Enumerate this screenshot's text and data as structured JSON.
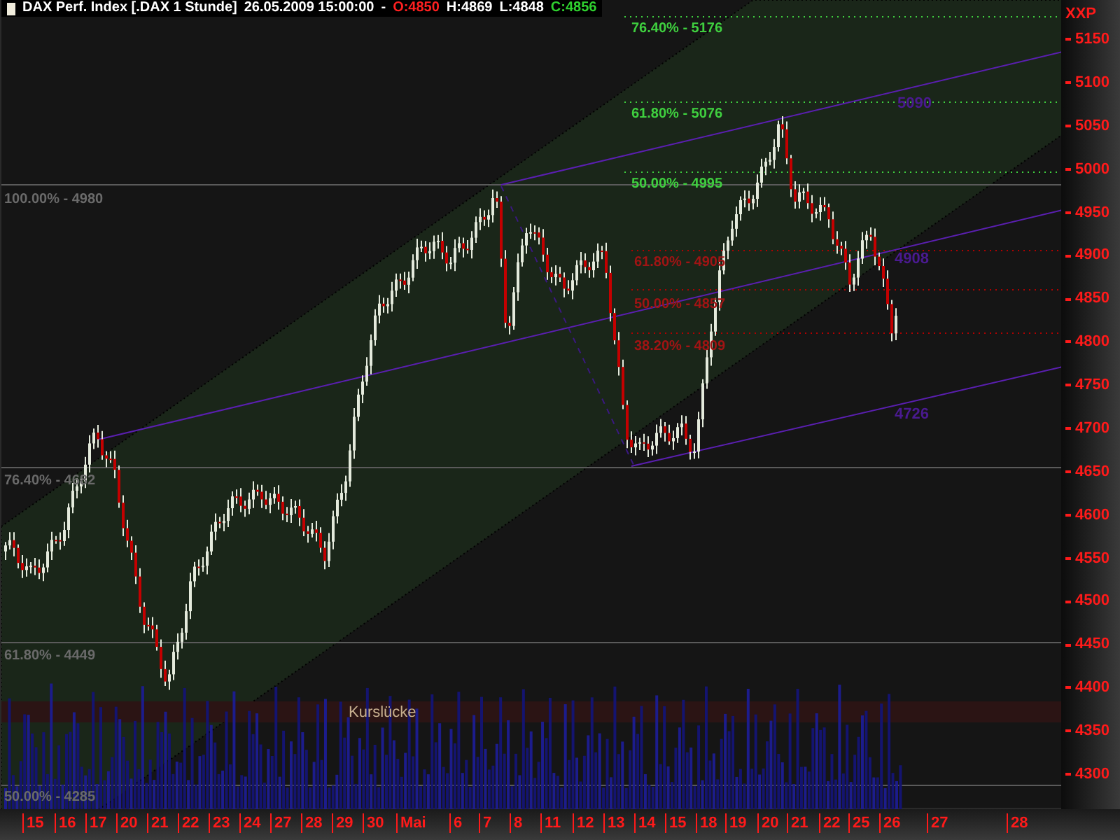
{
  "header": {
    "title": "DAX Perf. Index [.DAX  1 Stunde]",
    "datetime": "26.05.2009 15:00:00",
    "separator": "-",
    "quotes": [
      {
        "label": "O:4850",
        "kind": "open"
      },
      {
        "label": "H:4869",
        "kind": "high"
      },
      {
        "label": "L:4848",
        "kind": "low"
      },
      {
        "label": "C:4856",
        "kind": "close"
      }
    ]
  },
  "fib_levels": [
    {
      "label": "76.40% - 5176",
      "kind": "green"
    },
    {
      "label": "61.80% - 5076",
      "kind": "green"
    },
    {
      "label": "50.00% - 4995",
      "kind": "green"
    },
    {
      "label": "100.00% - 4980",
      "kind": "gray"
    },
    {
      "label": "76.40% - 4682",
      "kind": "gray"
    },
    {
      "label": "61.80% - 4449",
      "kind": "gray"
    },
    {
      "label": "50.00% - 4285",
      "kind": "gray"
    },
    {
      "label": "61.80% - 4905",
      "kind": "red"
    },
    {
      "label": "50.00% - 4857",
      "kind": "red"
    },
    {
      "label": "38.20% - 4809",
      "kind": "red"
    }
  ],
  "channel_labels": [
    "5090",
    "4908",
    "4726"
  ],
  "gap_label": "Kurslücke",
  "y_axis": {
    "unit": "XXP",
    "ticks": [
      "5150",
      "5100",
      "5050",
      "5000",
      "4950",
      "4900",
      "4850",
      "4800",
      "4750",
      "4700",
      "4650",
      "4600",
      "4550",
      "4500",
      "4450",
      "4400",
      "4350",
      "4300"
    ]
  },
  "x_axis": {
    "ticks": [
      "15",
      "16",
      "17",
      "20",
      "21",
      "22",
      "23",
      "24",
      "27",
      "28",
      "29",
      "30",
      "Mai",
      "6",
      "7",
      "8",
      "11",
      "12",
      "13",
      "14",
      "15",
      "18",
      "19",
      "20",
      "21",
      "22",
      "25",
      "26",
      "27",
      "28"
    ]
  }
}
